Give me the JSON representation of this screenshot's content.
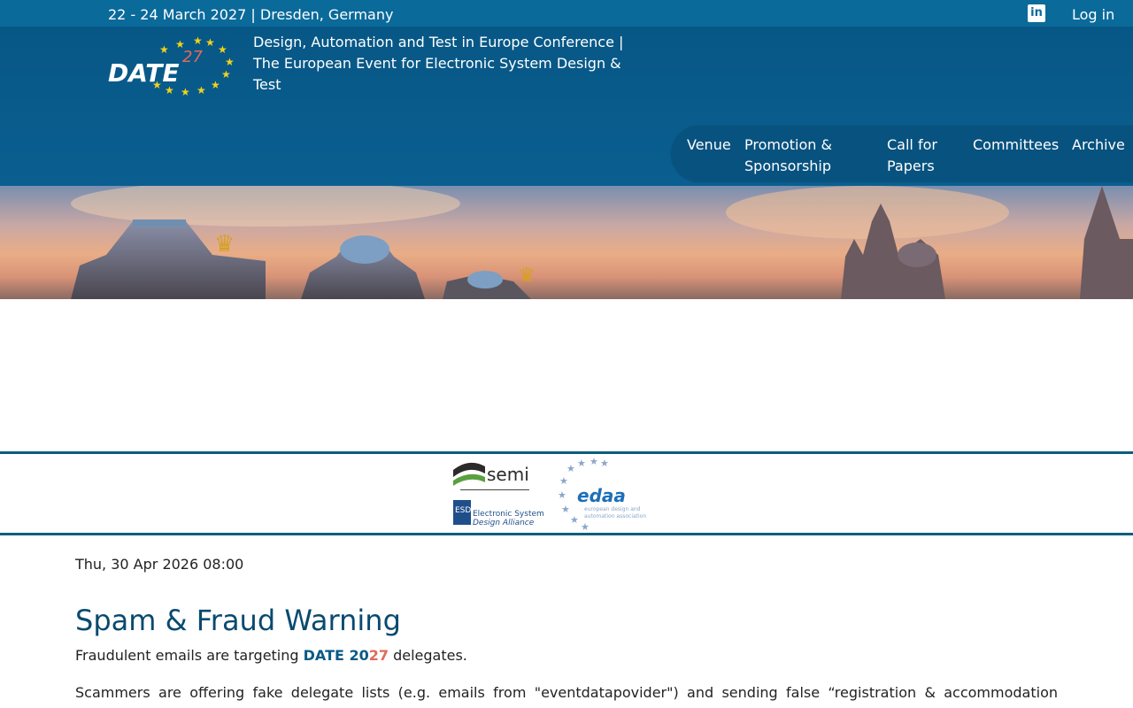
{
  "topbar": {
    "date_location": "22 - 24 March 2027 | Dresden, Germany",
    "linkedin_icon": "linkedin-icon",
    "login": "Log in"
  },
  "header": {
    "logo_text": "DATE",
    "logo_year": "27",
    "tagline": "Design, Automation and Test in Europe Conference | The European Event for Electronic System Design & Test"
  },
  "nav": {
    "items": [
      "Venue",
      "Promotion & Sponsorship",
      "Call for Papers",
      "Committees",
      "Archive"
    ]
  },
  "sponsors": {
    "semi": "semi",
    "esda_line1": "Electronic System",
    "esda_line2": "Design Alliance",
    "esda_mark": "ESDA",
    "edaa": "edaa",
    "edaa_sub1": "european design and",
    "edaa_sub2": "automation association"
  },
  "article": {
    "posted": "Thu, 30 Apr 2026 08:00",
    "title": "Spam & Fraud Warning",
    "intro_before": "Fraudulent emails are targeting ",
    "intro_date": "DATE 20",
    "intro_year": "27",
    "intro_after": " delegates.",
    "body": "Scammers are offering fake delegate lists (e.g. emails from \"eventdatapovider\") and sending false “registration & accommodation confirmation” emails (e.g. from XX) [image] or from a look-alike [.dt] zone) requesting credit card details."
  },
  "colors": {
    "topbar": "#0a6a9a",
    "header": "#075786",
    "nav": "#08527f",
    "title": "#0a4a6e",
    "accent_red": "#e06a5a",
    "star": "#f2d21b"
  }
}
